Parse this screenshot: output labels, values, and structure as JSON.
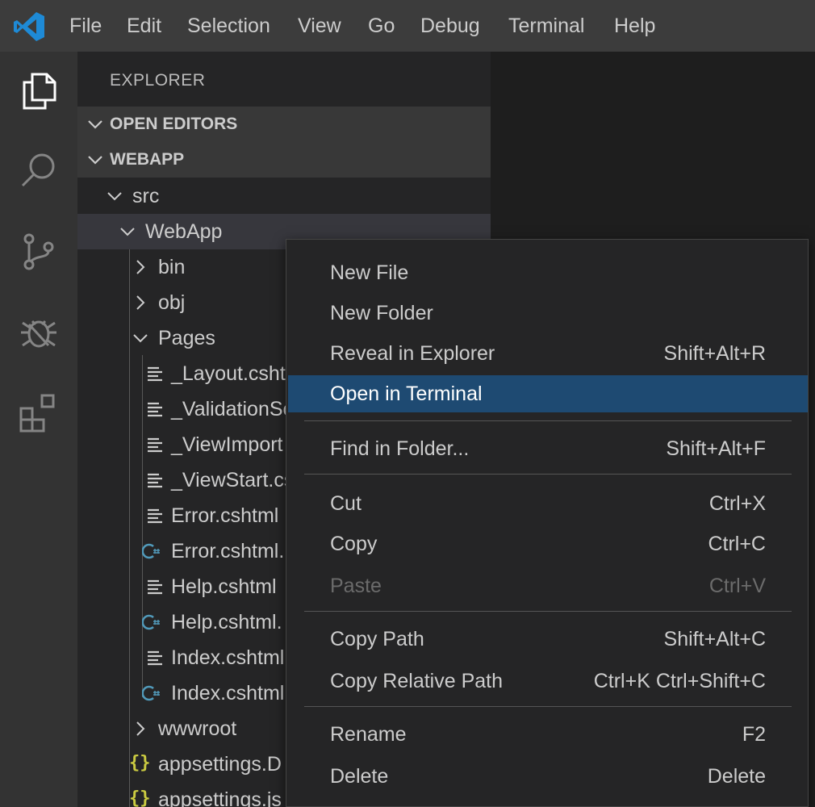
{
  "menubar": {
    "logo": "vscode-logo",
    "items": [
      "File",
      "Edit",
      "Selection",
      "View",
      "Go",
      "Debug",
      "Terminal",
      "Help"
    ]
  },
  "activitybar": {
    "icons": [
      "files-icon",
      "search-icon",
      "source-control-icon",
      "debug-icon",
      "extensions-icon"
    ]
  },
  "sidebar": {
    "title": "EXPLORER",
    "sections": [
      "OPEN EDITORS",
      "WEBAPP"
    ],
    "tree": [
      {
        "label": "src",
        "kind": "folder-open"
      },
      {
        "label": "WebApp",
        "kind": "folder-open"
      },
      {
        "label": "bin",
        "kind": "folder-closed"
      },
      {
        "label": "obj",
        "kind": "folder-closed"
      },
      {
        "label": "Pages",
        "kind": "folder-open"
      },
      {
        "label": "_Layout.csht",
        "kind": "razor-file"
      },
      {
        "label": "_ValidationSc",
        "kind": "razor-file"
      },
      {
        "label": "_ViewImport",
        "kind": "razor-file"
      },
      {
        "label": "_ViewStart.cs",
        "kind": "razor-file"
      },
      {
        "label": "Error.cshtml",
        "kind": "razor-file"
      },
      {
        "label": "Error.cshtml.",
        "kind": "csharp-file"
      },
      {
        "label": "Help.cshtml",
        "kind": "razor-file"
      },
      {
        "label": "Help.cshtml.",
        "kind": "csharp-file"
      },
      {
        "label": "Index.cshtml",
        "kind": "razor-file"
      },
      {
        "label": "Index.cshtml",
        "kind": "csharp-file"
      },
      {
        "label": "wwwroot",
        "kind": "folder-closed"
      },
      {
        "label": "appsettings.D",
        "kind": "json-file"
      },
      {
        "label": "appsettings.js",
        "kind": "json-file"
      }
    ]
  },
  "context_menu": {
    "items": [
      {
        "label": "New File",
        "shortcut": ""
      },
      {
        "label": "New Folder",
        "shortcut": ""
      },
      {
        "label": "Reveal in Explorer",
        "shortcut": "Shift+Alt+R"
      },
      {
        "label": "Open in Terminal",
        "shortcut": "",
        "state": "highlighted"
      },
      {
        "label": "Find in Folder...",
        "shortcut": "Shift+Alt+F"
      },
      {
        "label": "Cut",
        "shortcut": "Ctrl+X"
      },
      {
        "label": "Copy",
        "shortcut": "Ctrl+C"
      },
      {
        "label": "Paste",
        "shortcut": "Ctrl+V",
        "state": "disabled"
      },
      {
        "label": "Copy Path",
        "shortcut": "Shift+Alt+C"
      },
      {
        "label": "Copy Relative Path",
        "shortcut": "Ctrl+K Ctrl+Shift+C"
      },
      {
        "label": "Rename",
        "shortcut": "F2"
      },
      {
        "label": "Delete",
        "shortcut": "Delete"
      }
    ]
  },
  "colors": {
    "menubar_bg": "#3c3c3c",
    "activitybar_bg": "#333333",
    "sidebar_bg": "#252526",
    "menu_highlight": "#1e4a72",
    "vscode_blue": "#1e8ad6",
    "csharp_blue": "#519aba",
    "json_yellow": "#cbcb41"
  }
}
